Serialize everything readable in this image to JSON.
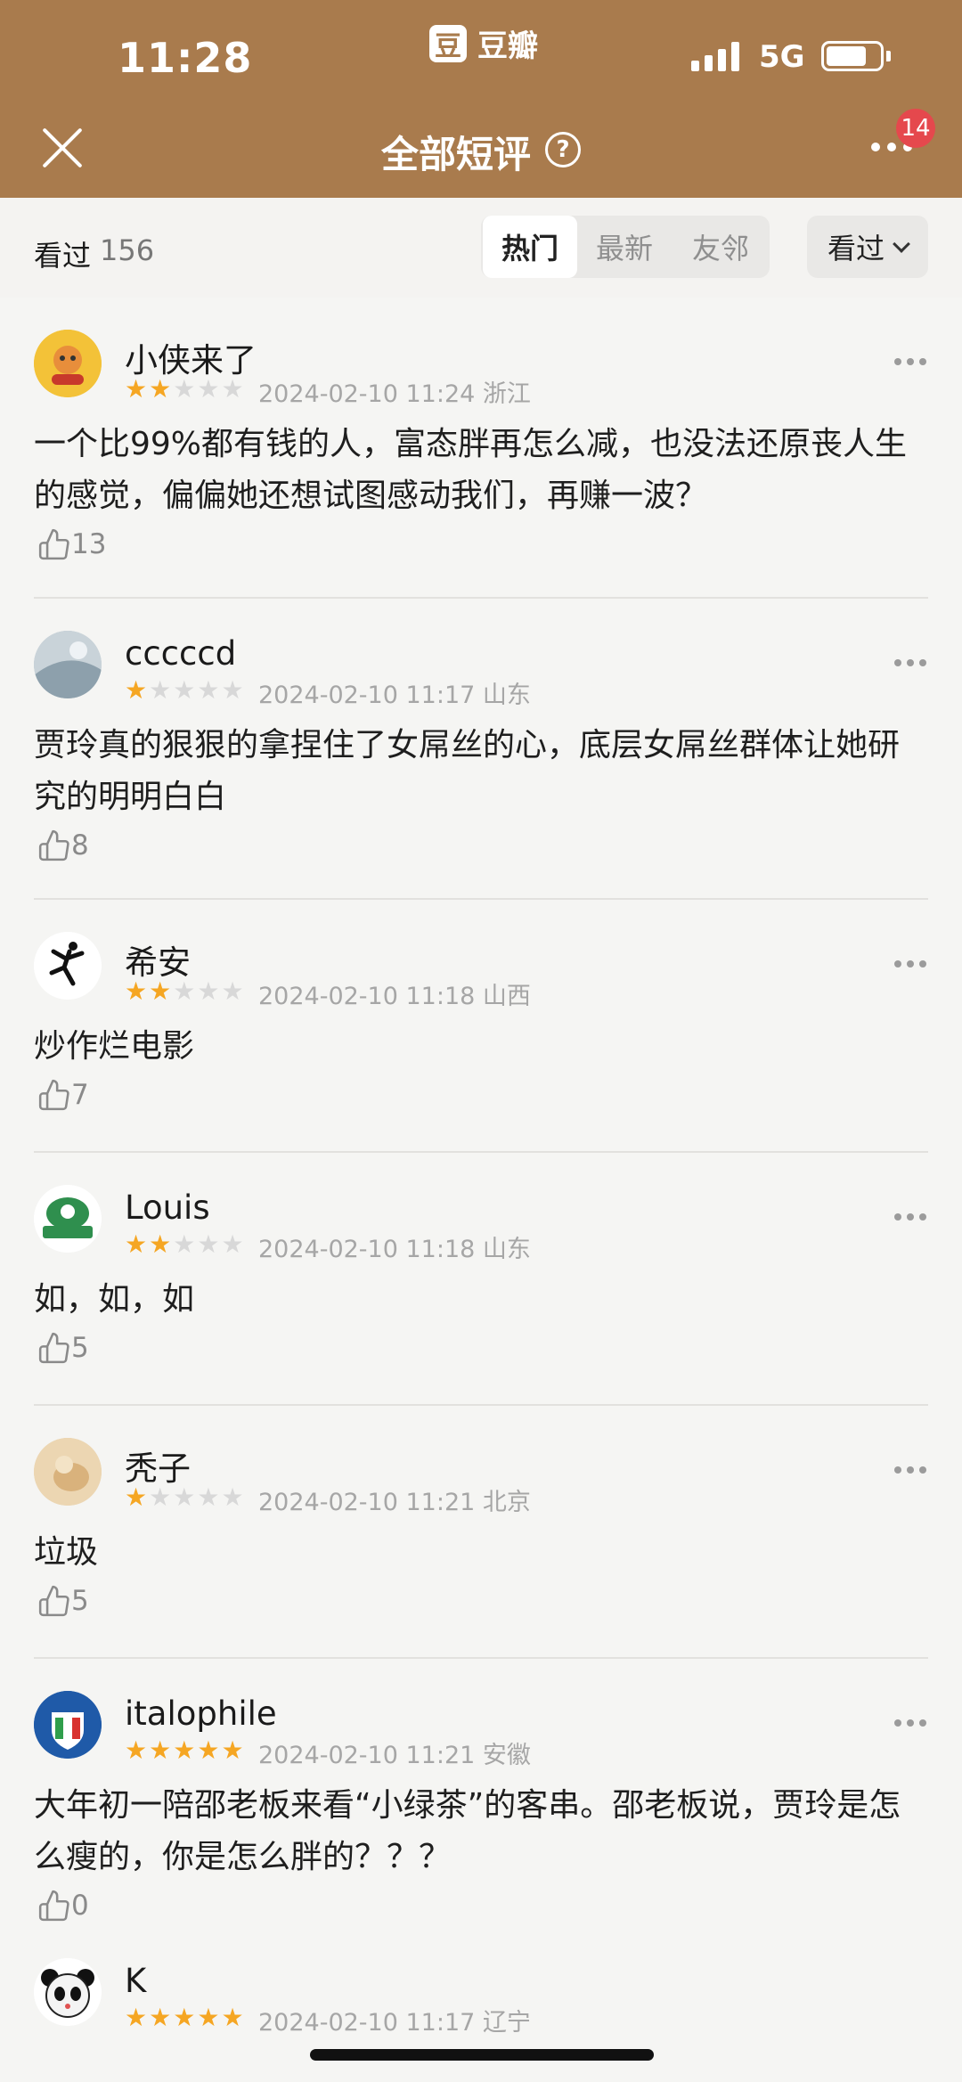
{
  "status_bar": {
    "time": "11:28",
    "app": "豆瓣",
    "network": "5G",
    "brand_logo_char": "豆"
  },
  "nav": {
    "title": "全部短评",
    "help": "?",
    "badge": "14"
  },
  "filter": {
    "watched_label": "看过",
    "watched_count": "156",
    "tabs": [
      "热门",
      "最新",
      "友邻"
    ],
    "active_tab": "热门",
    "dropdown": "看过"
  },
  "reviews": [
    {
      "user": "小侠来了",
      "rating": 2,
      "time": "2024-02-10 11:24",
      "location": "浙江",
      "content": "一个比99%都有钱的人，富态胖再怎么减，也没法还原丧人生的感觉，偏偏她还想试图感动我们，再赚一波？",
      "likes": "13",
      "avatar_color": "#f3c238"
    },
    {
      "user": "cccccd",
      "rating": 1,
      "time": "2024-02-10 11:17",
      "location": "山东",
      "content": "贾玲真的狠狠的拿捏住了女屌丝的心，底层女屌丝群体让她研究的明明白白",
      "likes": "8",
      "avatar_color": "#b8c4cc"
    },
    {
      "user": "希安",
      "rating": 2,
      "time": "2024-02-10 11:18",
      "location": "山西",
      "content": "炒作烂电影",
      "likes": "7",
      "avatar_color": "#ffffff"
    },
    {
      "user": "Louis",
      "rating": 2,
      "time": "2024-02-10 11:18",
      "location": "山东",
      "content": "如，如，如",
      "likes": "5",
      "avatar_color": "#2f8f4e"
    },
    {
      "user": "秃子",
      "rating": 1,
      "time": "2024-02-10 11:21",
      "location": "北京",
      "content": "垃圾",
      "likes": "5",
      "avatar_color": "#e8cfa6"
    },
    {
      "user": "italophile",
      "rating": 5,
      "time": "2024-02-10 11:21",
      "location": "安徽",
      "content": "大年初一陪邵老板来看“小绿茶”的客串。邵老板说，贾玲是怎么瘦的，你是怎么胖的？？？",
      "likes": "0",
      "avatar_color": "#1f5aa8"
    },
    {
      "user": "K",
      "rating": 5,
      "time": "2024-02-10 11:17",
      "location": "辽宁",
      "content": "",
      "likes": "",
      "avatar_color": "#ffffff"
    }
  ]
}
